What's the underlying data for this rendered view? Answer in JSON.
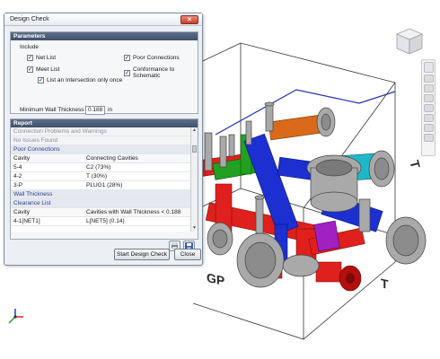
{
  "dialog": {
    "title": "Design Check",
    "close_glyph": "×",
    "parameters": {
      "header": "Parameters",
      "include_label": "Include",
      "options": {
        "net_list": {
          "label": "Net List",
          "checked": true
        },
        "meet_list": {
          "label": "Meet List",
          "checked": true
        },
        "intersection_once": {
          "label": "List an Intersection only once",
          "checked": true
        },
        "poor_connections": {
          "label": "Poor Connections",
          "checked": true
        },
        "conformance": {
          "label": "Conformance to Schematic",
          "checked": true
        }
      },
      "check_glyph": "✓",
      "min_wall_label": "Minimum Wall Thickness",
      "min_wall_value": "0.188",
      "min_wall_unit": "in"
    },
    "report": {
      "header": "Report",
      "connection_problems": "Connection Problems and Warnings",
      "no_issues": "No Issues Found",
      "poor_connections_title": "Poor Connections",
      "poor_columns": [
        "Cavity",
        "Connecting Cavities"
      ],
      "poor_rows": [
        [
          "5-4",
          "C2 (73%)"
        ],
        [
          "4-2",
          "T (30%)"
        ],
        [
          "3-P",
          "PLUG1 (28%)"
        ]
      ],
      "wall_thickness_title": "Wall Thickness",
      "clearance_title": "Clearance List",
      "clearance_columns": [
        "Cavity",
        "Cavities with Wall Thickness < 0.188"
      ],
      "clearance_rows": [
        [
          "4-1[NET1]",
          "L[NET5] (0.14)"
        ]
      ]
    },
    "buttons": {
      "start": "Start Design Check",
      "close": "Close"
    }
  },
  "viewport": {
    "labels": {
      "gp": "GP",
      "t": "T",
      "top_t": "T"
    }
  },
  "colors": {
    "header_bg": "#4a5c77",
    "link_blue": "#2e3f8f",
    "red": "#e0201c",
    "blue": "#1c2fd0",
    "green": "#22a022",
    "orange": "#d86a1a",
    "cyan": "#20b8c8",
    "purple": "#a020c0",
    "grey": "#9a9a9a"
  }
}
